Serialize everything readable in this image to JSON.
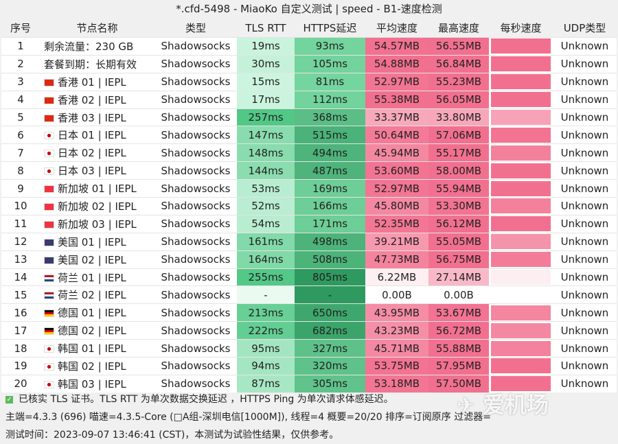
{
  "title": "*.cfd-5498 - MiaoKo 自定义测试 | speed - B1-速度检测",
  "columns": [
    "序号",
    "节点名称",
    "类型",
    "TLS RTT",
    "HTTPS延迟",
    "平均速度",
    "最高速度",
    "每秒速度",
    "UDP类型"
  ],
  "rows": [
    {
      "no": "1",
      "flag": "",
      "name": "剩余流量：230 GB",
      "type": "Shadowsocks",
      "tls": "19ms",
      "https": "93ms",
      "avg": "54.57MB",
      "max": "56.55MB",
      "udp": "Unknown"
    },
    {
      "no": "2",
      "flag": "",
      "name": "套餐到期：长期有效",
      "type": "Shadowsocks",
      "tls": "30ms",
      "https": "105ms",
      "avg": "54.88MB",
      "max": "56.84MB",
      "udp": "Unknown"
    },
    {
      "no": "3",
      "flag": "hk",
      "name": "香港 01 | IEPL",
      "type": "Shadowsocks",
      "tls": "15ms",
      "https": "81ms",
      "avg": "52.97MB",
      "max": "55.23MB",
      "udp": "Unknown"
    },
    {
      "no": "4",
      "flag": "hk",
      "name": "香港 02 | IEPL",
      "type": "Shadowsocks",
      "tls": "17ms",
      "https": "112ms",
      "avg": "55.38MB",
      "max": "56.05MB",
      "udp": "Unknown"
    },
    {
      "no": "5",
      "flag": "hk",
      "name": "香港 03 | IEPL",
      "type": "Shadowsocks",
      "tls": "257ms",
      "https": "368ms",
      "avg": "33.37MB",
      "max": "33.80MB",
      "udp": "Unknown"
    },
    {
      "no": "6",
      "flag": "jp",
      "name": "日本 01 | IEPL",
      "type": "Shadowsocks",
      "tls": "147ms",
      "https": "515ms",
      "avg": "50.64MB",
      "max": "57.06MB",
      "udp": "Unknown"
    },
    {
      "no": "7",
      "flag": "jp",
      "name": "日本 02 | IEPL",
      "type": "Shadowsocks",
      "tls": "148ms",
      "https": "494ms",
      "avg": "45.94MB",
      "max": "55.17MB",
      "udp": "Unknown"
    },
    {
      "no": "8",
      "flag": "jp",
      "name": "日本 03 | IEPL",
      "type": "Shadowsocks",
      "tls": "144ms",
      "https": "487ms",
      "avg": "53.60MB",
      "max": "58.00MB",
      "udp": "Unknown"
    },
    {
      "no": "9",
      "flag": "sg",
      "name": "新加坡 01 | IEPL",
      "type": "Shadowsocks",
      "tls": "53ms",
      "https": "169ms",
      "avg": "52.97MB",
      "max": "55.94MB",
      "udp": "Unknown"
    },
    {
      "no": "10",
      "flag": "sg",
      "name": "新加坡 02 | IEPL",
      "type": "Shadowsocks",
      "tls": "52ms",
      "https": "166ms",
      "avg": "45.80MB",
      "max": "53.30MB",
      "udp": "Unknown"
    },
    {
      "no": "11",
      "flag": "sg",
      "name": "新加坡 03 | IEPL",
      "type": "Shadowsocks",
      "tls": "54ms",
      "https": "171ms",
      "avg": "52.35MB",
      "max": "56.12MB",
      "udp": "Unknown"
    },
    {
      "no": "12",
      "flag": "us",
      "name": "美国 01 | IEPL",
      "type": "Shadowsocks",
      "tls": "161ms",
      "https": "498ms",
      "avg": "39.21MB",
      "max": "55.05MB",
      "udp": "Unknown"
    },
    {
      "no": "13",
      "flag": "us",
      "name": "美国 02 | IEPL",
      "type": "Shadowsocks",
      "tls": "164ms",
      "https": "508ms",
      "avg": "47.73MB",
      "max": "56.75MB",
      "udp": "Unknown"
    },
    {
      "no": "14",
      "flag": "nl",
      "name": "荷兰 01 | IEPL",
      "type": "Shadowsocks",
      "tls": "255ms",
      "https": "805ms",
      "avg": "6.22MB",
      "max": "27.14MB",
      "udp": "Unknown"
    },
    {
      "no": "15",
      "flag": "nl",
      "name": "荷兰 02 | IEPL",
      "type": "Shadowsocks",
      "tls": "-",
      "https": "-",
      "avg": "0.00B",
      "max": "0.00B",
      "udp": "Unknown"
    },
    {
      "no": "16",
      "flag": "de",
      "name": "德国 01 | IEPL",
      "type": "Shadowsocks",
      "tls": "213ms",
      "https": "650ms",
      "avg": "43.95MB",
      "max": "53.67MB",
      "udp": "Unknown"
    },
    {
      "no": "17",
      "flag": "de",
      "name": "德国 02 | IEPL",
      "type": "Shadowsocks",
      "tls": "222ms",
      "https": "682ms",
      "avg": "43.23MB",
      "max": "56.72MB",
      "udp": "Unknown"
    },
    {
      "no": "18",
      "flag": "kr",
      "name": "韩国 01 | IEPL",
      "type": "Shadowsocks",
      "tls": "95ms",
      "https": "327ms",
      "avg": "45.71MB",
      "max": "55.88MB",
      "udp": "Unknown"
    },
    {
      "no": "19",
      "flag": "kr",
      "name": "韩国 02 | IEPL",
      "type": "Shadowsocks",
      "tls": "94ms",
      "https": "320ms",
      "avg": "53.75MB",
      "max": "57.95MB",
      "udp": "Unknown"
    },
    {
      "no": "20",
      "flag": "kr",
      "name": "韩国 03 | IEPL",
      "type": "Shadowsocks",
      "tls": "87ms",
      "https": "305ms",
      "avg": "53.18MB",
      "max": "57.50MB",
      "udp": "Unknown"
    }
  ],
  "footer": {
    "line1": "已核实 TLS 证书。TLS RTT 为单次数据交换延迟 ，HTTPS Ping 为单次请求体感延迟。",
    "line2": "主端=4.3.3 (696) 喵速=4.3.5-Core (□A组-深圳电信[1000M]), 线程=4 概要=20/20 排序=订阅原序 过滤器=",
    "line3": "测试时间：2023-09-07 13:46:41 (CST)，本测试为试验性结果，仅供参考。"
  },
  "watermark": "爱机场",
  "colors": {
    "green_light": "#c9f3dd",
    "green_dark": "#2f9a5f",
    "pink": "#f2708f",
    "flags": {
      "hk": "#de2910",
      "jp": "#ffffff",
      "sg": "#ef3340",
      "us": "#3c3b6e",
      "nl": "#ae1c28",
      "de": "#000000",
      "kr": "#ffffff"
    }
  }
}
